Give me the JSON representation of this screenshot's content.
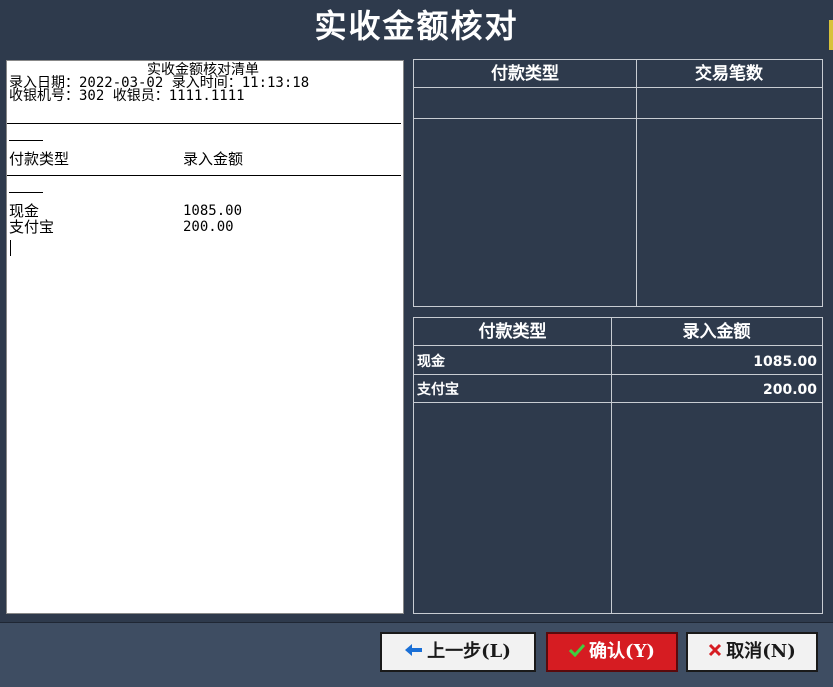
{
  "window": {
    "title": "实收金额核对"
  },
  "receipt": {
    "heading": "实收金额核对清单",
    "date_line": "录入日期：2022-03-02 录入时间：11:13:18",
    "till_line": "收银机号：302 收银员：1111.1111",
    "col_type": "付款类型",
    "col_amount": "录入金额",
    "rows": [
      {
        "type": "现金",
        "amount": "1085.00"
      },
      {
        "type": "支付宝",
        "amount": "200.00"
      }
    ]
  },
  "upper_table": {
    "columns": [
      "付款类型",
      "交易笔数"
    ]
  },
  "lower_table": {
    "columns": [
      "付款类型",
      "录入金额"
    ],
    "rows": [
      {
        "type": "现金",
        "amount": "1085.00"
      },
      {
        "type": "支付宝",
        "amount": "200.00"
      }
    ]
  },
  "buttons": {
    "prev": "上一步(L)",
    "confirm": "确认(Y)",
    "cancel": "取消(N)"
  },
  "icons": {
    "prev": "arrow-left-icon",
    "confirm": "check-icon",
    "cancel": "close-icon"
  },
  "colors": {
    "background": "#2e3a4c",
    "confirm_button": "#d61c22",
    "prev_icon": "#1a6fd6",
    "check_icon": "#3fcf3f",
    "close_icon": "#d61c22"
  }
}
